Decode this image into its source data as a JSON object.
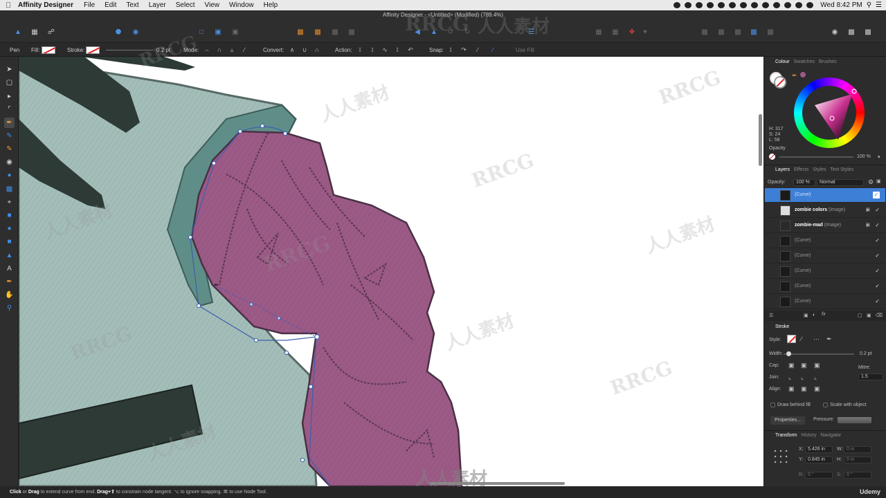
{
  "menubar": {
    "app_name": "Affinity Designer",
    "items": [
      "File",
      "Edit",
      "Text",
      "Layer",
      "Select",
      "View",
      "Window",
      "Help"
    ],
    "clock": "Wed 8:42 PM"
  },
  "window": {
    "title": "Affinity Designer - <Untitled> (Modified) (789.4%)"
  },
  "context_bar": {
    "tool": "Pen",
    "fill_label": "Fill:",
    "stroke_label": "Stroke:",
    "stroke_width": "0.2 pt",
    "mode_label": "Mode:",
    "convert_label": "Convert:",
    "action_label": "Action:",
    "snap_label": "Snap:",
    "use_fill": "Use Fill"
  },
  "colors": {
    "accent": "#3d7fd6",
    "shape_fill": "#9c5a86",
    "sleeve_fill": "#a3bdb8",
    "collar_fill": "#5f8e88",
    "dark_fill": "#2d3a36"
  },
  "colour_panel": {
    "tabs": [
      "Colour",
      "Swatches",
      "Brushes"
    ],
    "h": "H: 317",
    "s": "S: 24",
    "l": "L: 58",
    "opacity_label": "Opacity",
    "opacity_value": "100 %"
  },
  "layers_panel": {
    "tabs": [
      "Layers",
      "Effects",
      "Styles",
      "Text Styles"
    ],
    "opacity_label": "Opacity:",
    "opacity_value": "100 %",
    "blend_mode": "Normal",
    "layers": [
      {
        "name": "",
        "type": "(Curve)"
      },
      {
        "name": "zombie colors",
        "type": "(Image)"
      },
      {
        "name": "zombie-mad",
        "type": "(Image)"
      },
      {
        "name": "",
        "type": "(Curve)"
      },
      {
        "name": "",
        "type": "(Curve)"
      },
      {
        "name": "",
        "type": "(Curve)"
      },
      {
        "name": "",
        "type": "(Curve)"
      },
      {
        "name": "",
        "type": "(Curve)"
      }
    ]
  },
  "stroke_panel": {
    "title": "Stroke",
    "style_label": "Style:",
    "width_label": "Width:",
    "width_value": "0.2 pt",
    "cap_label": "Cap:",
    "join_label": "Join:",
    "align_label": "Align:",
    "mitre_label": "Mitre:",
    "mitre_value": "1.5",
    "draw_behind_fill": "Draw behind fill",
    "scale_with_object": "Scale with object",
    "properties_button": "Properties...",
    "pressure_label": "Pressure:"
  },
  "transform_panel": {
    "tabs": [
      "Transform",
      "History",
      "Navigator"
    ],
    "x_label": "X:",
    "x_value": "5.426 in",
    "y_label": "Y:",
    "y_value": "0.845 in",
    "w_label": "W:",
    "w_value": "0 in",
    "h_label": "H:",
    "h_value": "0 in",
    "r_label": "R:",
    "r_value": "0 °",
    "s_label": "S:",
    "s_value": "0 °"
  },
  "status": {
    "click": "Click",
    "or": " or ",
    "drag": "Drag",
    "text1": " to extend curve from end. ",
    "drag_shift": "Drag+⇧",
    "text2": " to constrain node tangent. ⌥ to ignore snapping. ⌘ to use Node Tool."
  },
  "watermarks": [
    "RRCG",
    "人人素材"
  ],
  "branding": {
    "udemy": "Udemy"
  }
}
